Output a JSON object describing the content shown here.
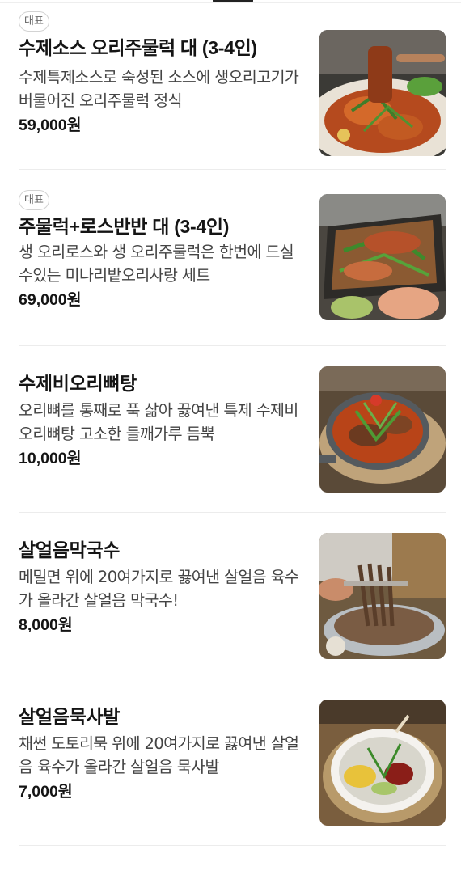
{
  "menu": {
    "items": [
      {
        "badge": "대표",
        "name": "수제소스 오리주물럭 대 (3-4인)",
        "description": "수제특제소스로 숙성된 소스에 생오리고기가 버물어진 오리주물럭 정식",
        "price": "59,000원",
        "image_icon": "duck-bulgogi-photo"
      },
      {
        "badge": "대표",
        "name": "주물럭+로스반반 대 (3-4인)",
        "description": "생 오리로스와 생 오리주물럭은 한번에 드실수있는 미나리밭오리사랑 세트",
        "price": "69,000원",
        "image_icon": "duck-grill-photo"
      },
      {
        "badge": "",
        "name": "수제비오리뼈탕",
        "description": "오리뼈를 통째로 푹 삶아 끓여낸 특제 수제비 오리뼈탕 고소한 들깨가루 듬뿍",
        "price": "10,000원",
        "image_icon": "bone-soup-photo"
      },
      {
        "badge": "",
        "name": "살얼음막국수",
        "description": "메밀면 위에 20여가지로 끓여낸 살얼음 육수가 올라간 살얼음 막국수!",
        "price": "8,000원",
        "image_icon": "buckwheat-noodle-photo"
      },
      {
        "badge": "",
        "name": "살얼음묵사발",
        "description": "채썬 도토리묵 위에 20여가지로 끓여낸 살얼음 육수가 올라간 살얼음 묵사발",
        "price": "7,000원",
        "image_icon": "acorn-jelly-bowl-photo"
      }
    ]
  }
}
